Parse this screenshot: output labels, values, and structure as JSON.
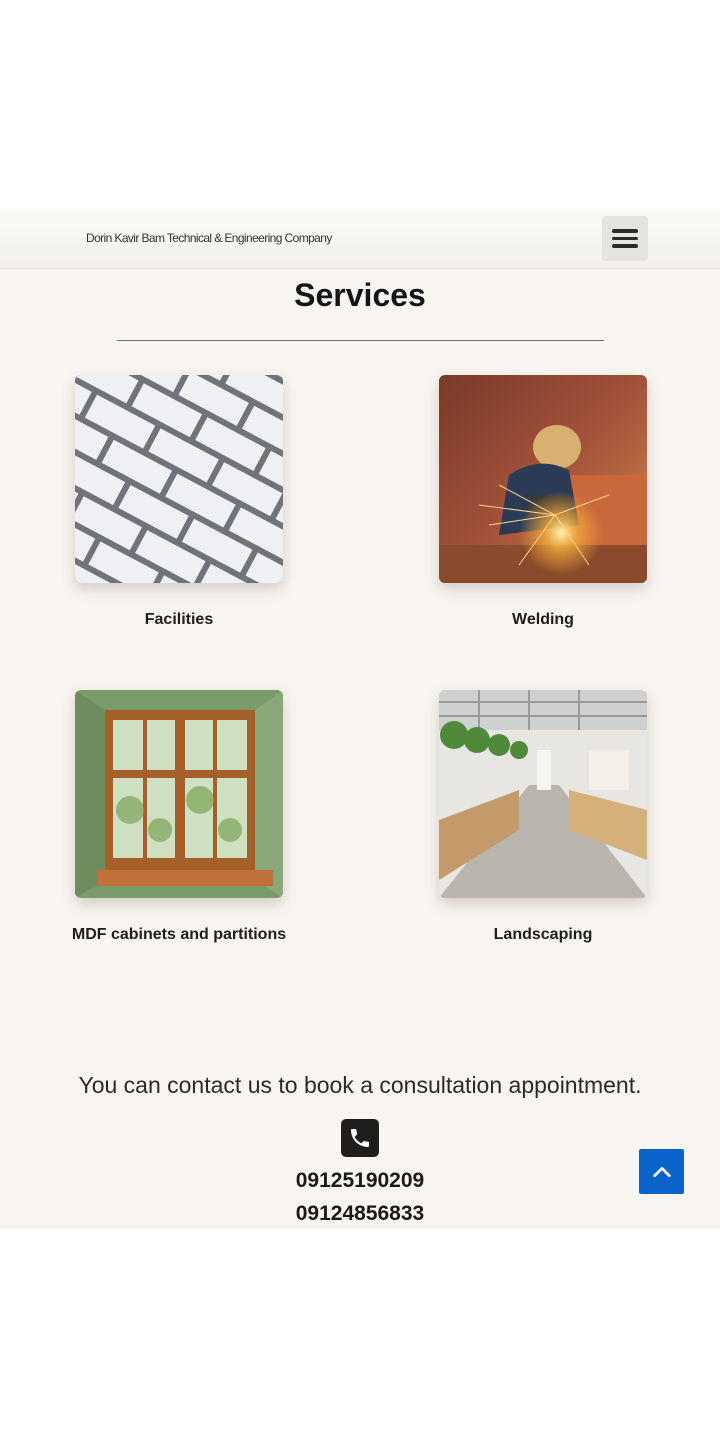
{
  "header": {
    "brand": "Dorin Kavir Bam Technical & Engineering Company",
    "menu_icon": "hamburger-menu-icon"
  },
  "services": {
    "title": "Services",
    "items": [
      {
        "label": "Facilities",
        "image": "brick-wall-photo"
      },
      {
        "label": "Welding",
        "image": "welder-sparks-photo"
      },
      {
        "label": "MDF cabinets and partitions",
        "image": "wooden-window-photo"
      },
      {
        "label": "Landscaping",
        "image": "office-interior-plants-photo"
      }
    ]
  },
  "contact": {
    "text": "You can contact us to book a consultation appointment.",
    "icon": "phone-icon",
    "phones": [
      "09125190209",
      "09124856833"
    ]
  },
  "scroll_top": {
    "icon": "chevron-up-icon"
  },
  "colors": {
    "page_bg": "#f8f5f1",
    "accent": "#0a63c9",
    "text": "#1c1c1c"
  }
}
